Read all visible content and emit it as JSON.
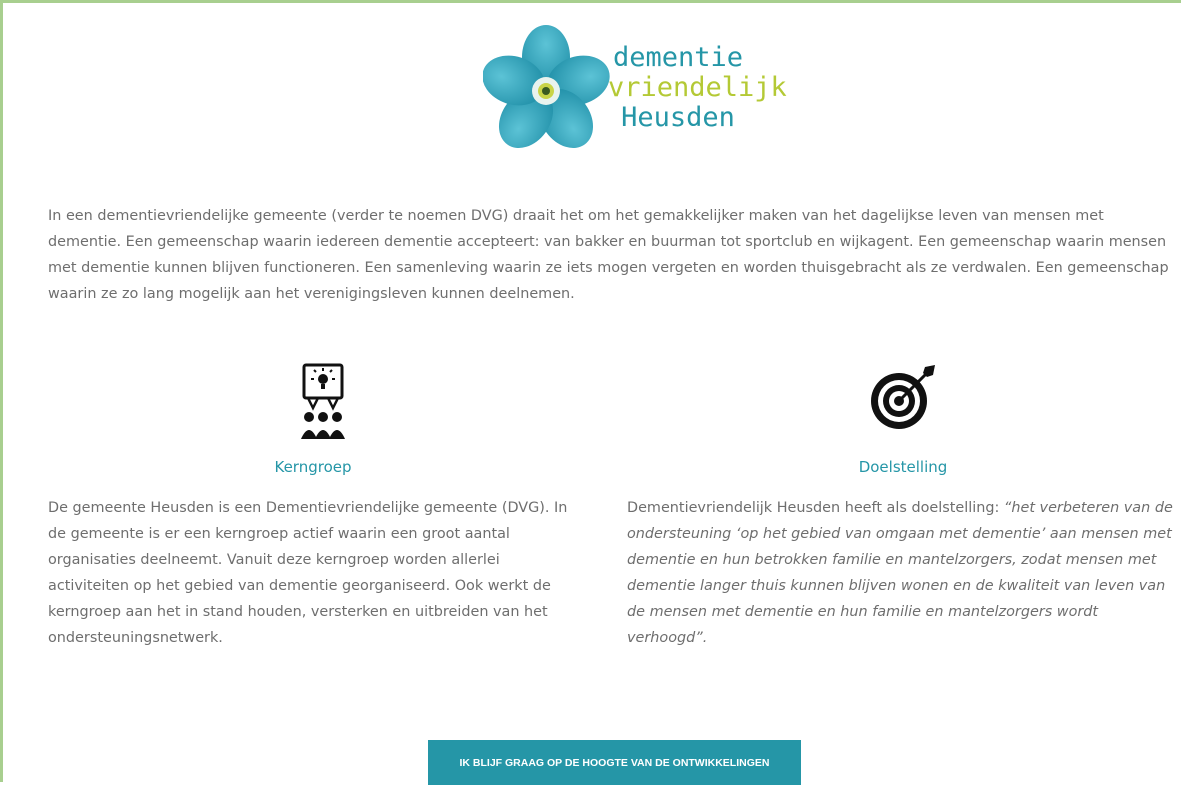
{
  "logo": {
    "line1": "dementie",
    "line2": "vriendelijk",
    "line3": "Heusden",
    "colors": {
      "teal": "#2596a7",
      "green": "#b4c935",
      "petal": "#2aa0b8"
    }
  },
  "intro": {
    "text": "In een dementievriendelijke gemeente (verder te noemen DVG) draait het om het gemakkelijker maken van het dagelijkse leven van mensen met dementie. Een gemeenschap waarin iedereen dementie accepteert: van bakker en buurman tot sportclub en wijkagent. Een gemeenschap waarin mensen met dementie kunnen blijven functioneren. Een samenleving waarin ze iets mogen vergeten en worden thuisgebracht als ze verdwalen. Een gemeenschap waarin ze zo lang mogelijk aan het verenigingsleven kunnen deelnemen."
  },
  "kerngroep": {
    "icon": "presentation-group-icon",
    "title": "Kerngroep",
    "text": "De gemeente Heusden is een Dementievriendelijke gemeente (DVG). In de gemeente is er een kerngroep actief waarin een groot aantal organisaties deelneemt. Vanuit deze kerngroep worden allerlei activiteiten op het gebied van dementie georganiseerd. Ook werkt de kerngroep aan het in stand houden, versterken en uitbreiden van het ondersteuningsnetwerk."
  },
  "doelstelling": {
    "icon": "target-icon",
    "title": "Doelstelling",
    "text_prefix": "Dementievriendelijk Heusden heeft als doelstelling: ",
    "text_quote": "“het verbeteren van de ondersteuning ‘op het gebied van omgaan met dementie’ aan mensen met dementie en hun betrokken familie en mantelzorgers, zodat mensen met dementie langer thuis kunnen blijven wonen en de kwaliteit van leven van de mensen met dementie en hun familie en mantelzorgers wordt verhoogd”."
  },
  "cta": {
    "label": "IK BLIJF GRAAG OP DE HOOGTE VAN DE ONTWIKKELINGEN",
    "color": "#2596a7"
  }
}
